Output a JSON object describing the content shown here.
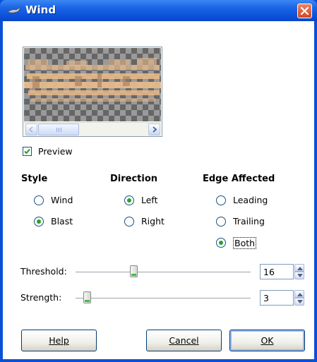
{
  "window": {
    "title": "Wind"
  },
  "preview": {
    "checkbox_label": "Preview",
    "checked": true
  },
  "style": {
    "header": "Style",
    "options": [
      {
        "label": "Wind",
        "selected": false
      },
      {
        "label": "Blast",
        "selected": true
      }
    ]
  },
  "direction": {
    "header": "Direction",
    "options": [
      {
        "label": "Left",
        "selected": true
      },
      {
        "label": "Right",
        "selected": false
      }
    ]
  },
  "edge": {
    "header": "Edge Affected",
    "options": [
      {
        "label": "Leading",
        "selected": false
      },
      {
        "label": "Trailing",
        "selected": false
      },
      {
        "label": "Both",
        "selected": true
      }
    ]
  },
  "threshold": {
    "label": "Threshold:",
    "value": "16",
    "fraction": 0.34
  },
  "strength": {
    "label": "Strength:",
    "value": "3",
    "fraction": 0.03
  },
  "buttons": {
    "help": "Help",
    "cancel": "Cancel",
    "ok": "OK"
  },
  "colors": {
    "title_bar": "#0a4fd8",
    "close": "#d3481f",
    "accent_green": "#2aa12a"
  }
}
